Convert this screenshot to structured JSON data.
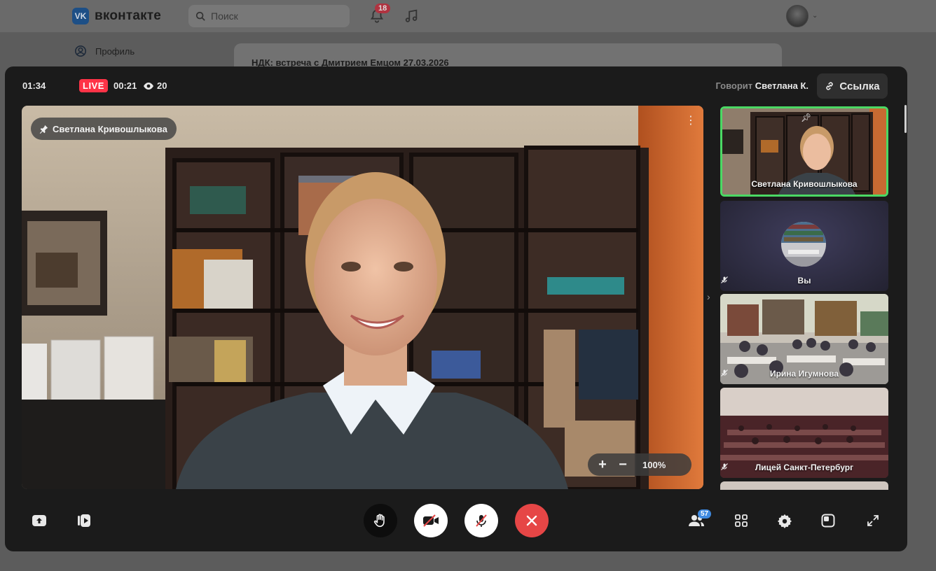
{
  "vk": {
    "logo_text": "вконтакте",
    "search_placeholder": "Поиск",
    "notifications_count": "18",
    "profile_label": "Профиль",
    "post_title": "НДК: встреча с Дмитрием Емцом 27.03.2026"
  },
  "call": {
    "elapsed": "01:34",
    "live_label": "LIVE",
    "live_duration": "00:21",
    "viewers": "20",
    "speaking_prefix": "Говорит",
    "speaking_name": "Светлана К.",
    "link_label": "Ссылка",
    "main": {
      "pinned_name": "Светлана Кривошлыкова",
      "zoom": "100%"
    },
    "participants": [
      {
        "name": "Светлана Кривошлыкова",
        "pinned": true,
        "active": true,
        "muted": false
      },
      {
        "name": "Вы",
        "muted": true
      },
      {
        "name": "Ирина Игумнова",
        "muted": true
      },
      {
        "name": "Лицей Санкт-Петербург",
        "muted": true
      }
    ],
    "participants_count": "57"
  },
  "colors": {
    "live": "#ff3347",
    "active_border": "#4bd964",
    "end_call": "#e64646",
    "count_badge": "#3f8ae0"
  },
  "icons": [
    "search-icon",
    "bell-icon",
    "music-icon",
    "user-icon",
    "link-icon",
    "eye-icon",
    "pin-icon",
    "more-icon",
    "screen-share-icon",
    "record-icon",
    "raise-hand-icon",
    "camera-off-icon",
    "mic-off-icon",
    "end-call-icon",
    "participants-icon",
    "grid-icon",
    "settings-icon",
    "layout-icon",
    "fullscreen-icon",
    "chevron-right-icon"
  ]
}
